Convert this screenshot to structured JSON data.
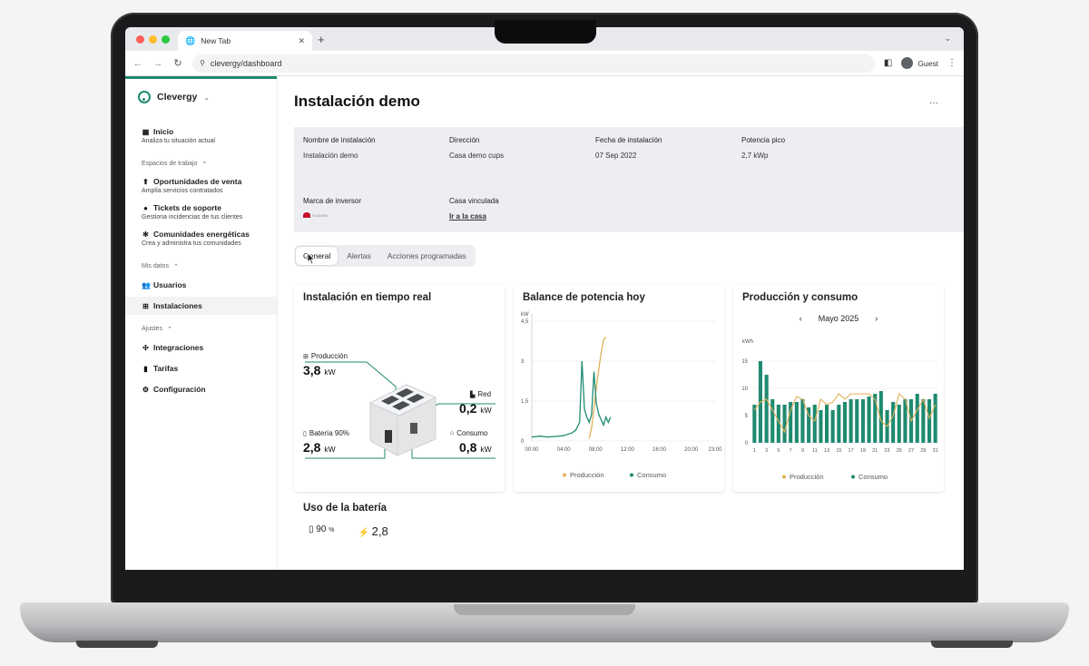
{
  "browser": {
    "tab_title": "New Tab",
    "url": "clevergy/dashboard",
    "profile_label": "Guest"
  },
  "sidebar": {
    "brand": "Clevergy",
    "inicio": {
      "label": "Inicio",
      "sub": "Analiza tu situación actual"
    },
    "section_workspaces": "Espacios de trabajo",
    "oportunidades": {
      "label": "Oportunidades de venta",
      "sub": "Amplía servicios contratados"
    },
    "tickets": {
      "label": "Tickets de soporte",
      "sub": "Gestiona incidencias de tus  clientes"
    },
    "comunidades": {
      "label": "Comunidades energéticas",
      "sub": "Crea y administra tus comunidades"
    },
    "section_data": "Mis datos",
    "usuarios": "Usuarios",
    "instalaciones": "Instalaciones",
    "section_settings": "Ajustes",
    "integraciones": "Integraciones",
    "tarifas": "Tarifas",
    "configuracion": "Configuración"
  },
  "page": {
    "title": "Instalación demo",
    "more_label": "···"
  },
  "info": {
    "nombre_label": "Nombre de instalación",
    "nombre_value": "Instalación demo",
    "direccion_label": "Dirección",
    "direccion_value": "Casa demo cups",
    "fecha_label": "Fecha de instalación",
    "fecha_value": "07 Sep 2022",
    "potencia_label": "Potencia pico",
    "potencia_value": "2,7 kWp",
    "marca_label": "Marca de inversor",
    "marca_value": "HUAWEI",
    "casa_label": "Casa vinculada",
    "casa_link": "Ir a la casa"
  },
  "tabs": [
    "General",
    "Alertas",
    "Acciones programadas"
  ],
  "realtime": {
    "title": "Instalación en tiempo real",
    "produccion_label": "Producción",
    "produccion_value": "3,8",
    "red_label": "Red",
    "red_value": "0,2",
    "bateria_label": "Batería 90%",
    "bateria_value": "2,8",
    "consumo_label": "Consumo",
    "consumo_value": "0,8",
    "unit": "kW"
  },
  "colors": {
    "accent": "#1f8a70",
    "produccion": "#e0b157",
    "consumo": "#1f8a70"
  },
  "chart_data": [
    {
      "type": "line",
      "title": "Balance de potencia hoy",
      "ylabel": "kW",
      "ylim": [
        0,
        4.5
      ],
      "yticks": [
        "0",
        "1,5",
        "3",
        "4,5"
      ],
      "x_ticks": [
        "00:00",
        "04:00",
        "08:00",
        "12:00",
        "16:00",
        "20:00",
        "23:00"
      ],
      "x": [
        0,
        1,
        2,
        3,
        4,
        5,
        5.5,
        6,
        6.3,
        6.6,
        6.9,
        7.2,
        7.5,
        7.8,
        8.1,
        8.4,
        8.7,
        9,
        9.3,
        9.6,
        9.9
      ],
      "series": [
        {
          "name": "Producción",
          "values": [
            null,
            null,
            null,
            null,
            null,
            null,
            null,
            null,
            null,
            null,
            null,
            0.1,
            0.5,
            1.2,
            2.0,
            2.7,
            3.3,
            3.8,
            3.9,
            null,
            null
          ]
        },
        {
          "name": "Consumo",
          "values": [
            0.15,
            0.18,
            0.15,
            0.17,
            0.2,
            0.3,
            0.4,
            0.7,
            3.0,
            1.2,
            0.9,
            0.7,
            1.0,
            2.6,
            1.4,
            1.0,
            0.8,
            0.6,
            0.9,
            0.7,
            0.9
          ]
        }
      ],
      "legend": "bottom"
    },
    {
      "type": "bar",
      "title": "Producción y consumo",
      "period_label": "Mayo 2025",
      "ylabel": "kWh",
      "ylim": [
        0,
        20
      ],
      "yticks": [
        "0",
        "5",
        "10",
        "15"
      ],
      "categories": [
        "1",
        "2",
        "3",
        "4",
        "5",
        "6",
        "7",
        "8",
        "9",
        "10",
        "11",
        "12",
        "13",
        "14",
        "15",
        "16",
        "17",
        "18",
        "19",
        "20",
        "21",
        "22",
        "23",
        "24",
        "25",
        "26",
        "27",
        "28",
        "29",
        "30",
        "31"
      ],
      "x_tick_labels": [
        "1",
        "3",
        "5",
        "7",
        "9",
        "11",
        "13",
        "15",
        "17",
        "19",
        "21",
        "23",
        "25",
        "27",
        "29",
        "31"
      ],
      "series": [
        {
          "name": "Consumo",
          "values": [
            7,
            15,
            12.5,
            8,
            7,
            7,
            7.5,
            7.5,
            8,
            6.5,
            7,
            6,
            7,
            6,
            7,
            7.5,
            8,
            8,
            8,
            8.5,
            9,
            9.5,
            6,
            7.5,
            7,
            8,
            8,
            9,
            8,
            8,
            9
          ]
        },
        {
          "name": "Producción",
          "values": [
            6,
            7.5,
            8,
            6,
            4,
            2,
            6,
            8.5,
            8,
            5,
            4,
            8,
            7,
            7.5,
            9,
            8,
            9,
            9,
            9,
            9,
            8,
            4,
            3,
            5,
            9,
            8,
            4,
            6,
            8,
            4.5,
            7
          ]
        }
      ],
      "legend": "bottom"
    }
  ],
  "battery": {
    "title": "Uso de la batería",
    "percent": "90",
    "percent_unit": "%",
    "power": "2,8"
  }
}
